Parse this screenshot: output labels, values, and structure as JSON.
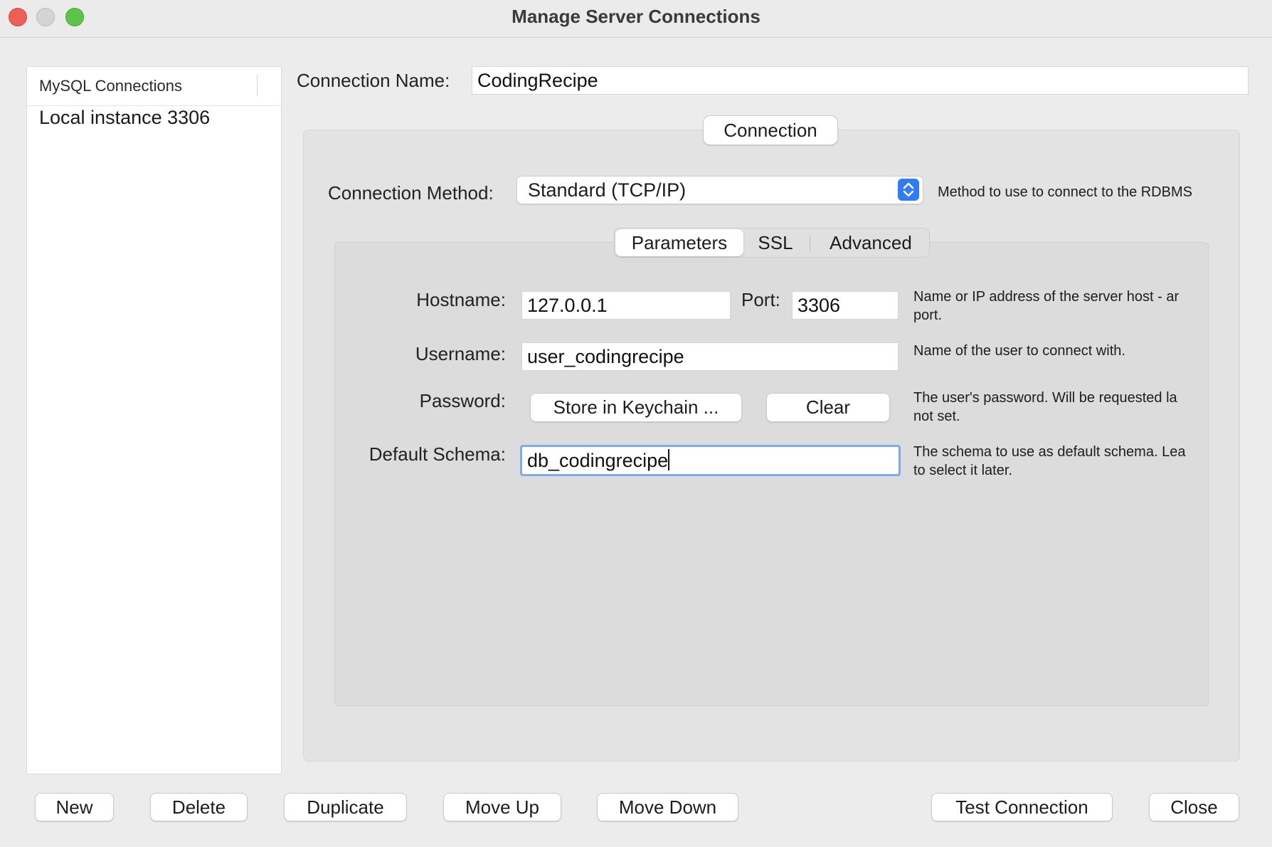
{
  "window": {
    "title": "Manage Server Connections"
  },
  "sidebar": {
    "header": "MySQL Connections",
    "items": [
      {
        "label": "Local instance 3306"
      }
    ]
  },
  "form": {
    "connection_name_label": "Connection Name:",
    "connection_name_value": "CodingRecipe",
    "group_tab": "Connection",
    "method_label": "Connection Method:",
    "method_value": "Standard (TCP/IP)",
    "method_help": "Method to use to connect to the RDBMS",
    "tabs": [
      {
        "label": "Parameters"
      },
      {
        "label": "SSL"
      },
      {
        "label": "Advanced"
      }
    ],
    "hostname_label": "Hostname:",
    "hostname_value": "127.0.0.1",
    "port_label": "Port:",
    "port_value": "3306",
    "hostname_help_1": "Name or IP address of the server host - ar",
    "hostname_help_2": "port.",
    "username_label": "Username:",
    "username_value": "user_codingrecipe",
    "username_help": "Name of the user to connect with.",
    "password_label": "Password:",
    "store_keychain": "Store in Keychain ...",
    "clear": "Clear",
    "password_help_1": "The user's password. Will be requested la",
    "password_help_2": "not set.",
    "schema_label": "Default Schema:",
    "schema_value": "db_codingrecipe",
    "schema_help_1": "The schema to use as default schema. Lea",
    "schema_help_2": "to select it later."
  },
  "footer": {
    "new": "New",
    "delete": "Delete",
    "duplicate": "Duplicate",
    "move_up": "Move Up",
    "move_down": "Move Down",
    "test_connection": "Test Connection",
    "close": "Close"
  },
  "colors": {
    "accent": "#2f7cf6",
    "focus_ring": "#7fa8ee",
    "window_bg": "#ececec"
  },
  "icons": {
    "stepper": "up-down-chevron-icon"
  }
}
